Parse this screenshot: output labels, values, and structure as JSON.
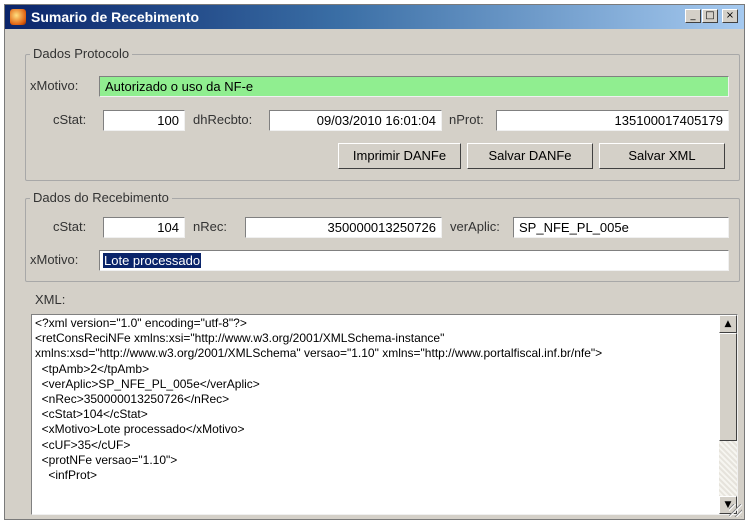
{
  "window": {
    "title": "Sumario de Recebimento",
    "minimize_symbol": "_",
    "maximize_symbol": "□",
    "close_symbol": "×"
  },
  "protocolo": {
    "legend": "Dados Protocolo",
    "xmotivo_label": "xMotivo:",
    "xmotivo_value": "Autorizado o uso da NF-e",
    "cstat_label": "cStat:",
    "cstat_value": "100",
    "dhrecbto_label": "dhRecbto:",
    "dhrecbto_value": "09/03/2010 16:01:04",
    "nprot_label": "nProt:",
    "nprot_value": "135100017405179",
    "buttons": {
      "imprimir": "Imprimir DANFe",
      "salvar_danfe": "Salvar DANFe",
      "salvar_xml": "Salvar XML"
    }
  },
  "recebimento": {
    "legend": "Dados do Recebimento",
    "cstat_label": "cStat:",
    "cstat_value": "104",
    "nrec_label": "nRec:",
    "nrec_value": "350000013250726",
    "veraplic_label": "verAplic:",
    "veraplic_value": "SP_NFE_PL_005e",
    "xmotivo_label": "xMotivo:",
    "xmotivo_value": "Lote processado"
  },
  "xml": {
    "label": "XML:",
    "content": "<?xml version=\"1.0\" encoding=\"utf-8\"?>\n<retConsReciNFe xmlns:xsi=\"http://www.w3.org/2001/XMLSchema-instance\"\nxmlns:xsd=\"http://www.w3.org/2001/XMLSchema\" versao=\"1.10\" xmlns=\"http://www.portalfiscal.inf.br/nfe\">\n  <tpAmb>2</tpAmb>\n  <verAplic>SP_NFE_PL_005e</verAplic>\n  <nRec>350000013250726</nRec>\n  <cStat>104</cStat>\n  <xMotivo>Lote processado</xMotivo>\n  <cUF>35</cUF>\n  <protNFe versao=\"1.10\">\n    <infProt>",
    "scroll_up_symbol": "▲",
    "scroll_down_symbol": "▼"
  },
  "colors": {
    "title_bar": "#0a246a",
    "authorized_field": "#90ee90",
    "selection": "#0a246a",
    "window_face": "#d4d0c8"
  }
}
